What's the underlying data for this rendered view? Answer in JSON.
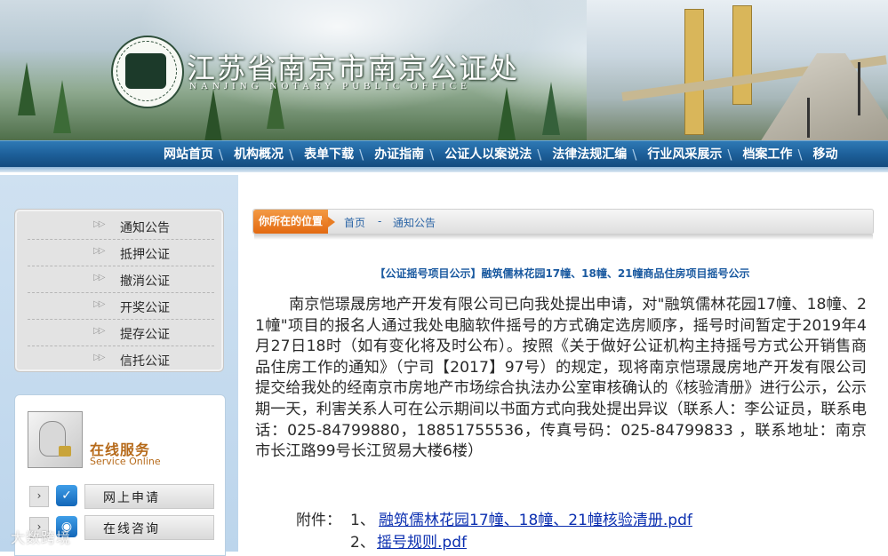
{
  "header": {
    "title": "江苏省南京市南京公证处",
    "subtitle": "NANJING NOTARY PUBLIC OFFICE",
    "logo_text_top": "南京公证处",
    "logo_text_ring": "NANJING NOTARY PUBLIC OFFICE"
  },
  "nav": {
    "items": [
      "网站首页",
      "机构概况",
      "表单下载",
      "办证指南",
      "公证人以案说法",
      "法律法规汇编",
      "行业风采展示",
      "档案工作",
      "移动"
    ]
  },
  "sidebar": {
    "menu": [
      {
        "label": "通知公告"
      },
      {
        "label": "抵押公证"
      },
      {
        "label": "撤消公证"
      },
      {
        "label": "开奖公证"
      },
      {
        "label": "提存公证"
      },
      {
        "label": "信托公证"
      }
    ],
    "service": {
      "title_cn": "在线服务",
      "title_en": "Service Online",
      "items": [
        {
          "label": "网上申请",
          "icon": "checklist-icon"
        },
        {
          "label": "在线咨询",
          "icon": "chat-icon"
        }
      ]
    }
  },
  "breadcrumb": {
    "label": "你所在的位置",
    "home": "首页",
    "sep": "-",
    "current": "通知公告"
  },
  "article": {
    "title": "【公证摇号项目公示】融筑儒林花园17幢、18幢、21幢商品住房项目摇号公示",
    "body": "南京恺璟晟房地产开发有限公司已向我处提出申请，对\"融筑儒林花园17幢、18幢、21幢\"项目的报名人通过我处电脑软件摇号的方式确定选房顺序，摇号时间暂定于2019年4月27日18时（如有变化将及时公布）。按照《关于做好公证机构主持摇号方式公开销售商品住房工作的通知》（宁司【2017】97号）的规定，现将南京恺璟晟房地产开发有限公司提交给我处的经南京市房地产市场综合执法办公室审核确认的《核验清册》进行公示，公示期一天，利害关系人可在公示期间以书面方式向我处提出异议（联系人：李公证员，联系电话：025-84799880，18851755536，传真号码：025-84799833 ，联系地址：南京市长江路99号长江贸易大楼6楼）",
    "attach_label": "附件：",
    "attachments": [
      {
        "num": "1、",
        "name": "融筑儒林花园17幢、18幢、21幢核验清册.pdf"
      },
      {
        "num": "2、",
        "name": "摇号规则.pdf"
      }
    ]
  },
  "watermark": "大数跨境",
  "colors": {
    "nav_bg": "#1d5f99",
    "link": "#0b2fb0",
    "title_blue": "#1b5aa0",
    "crumb_orange": "#e36a11",
    "service_orange": "#b66a1a"
  }
}
